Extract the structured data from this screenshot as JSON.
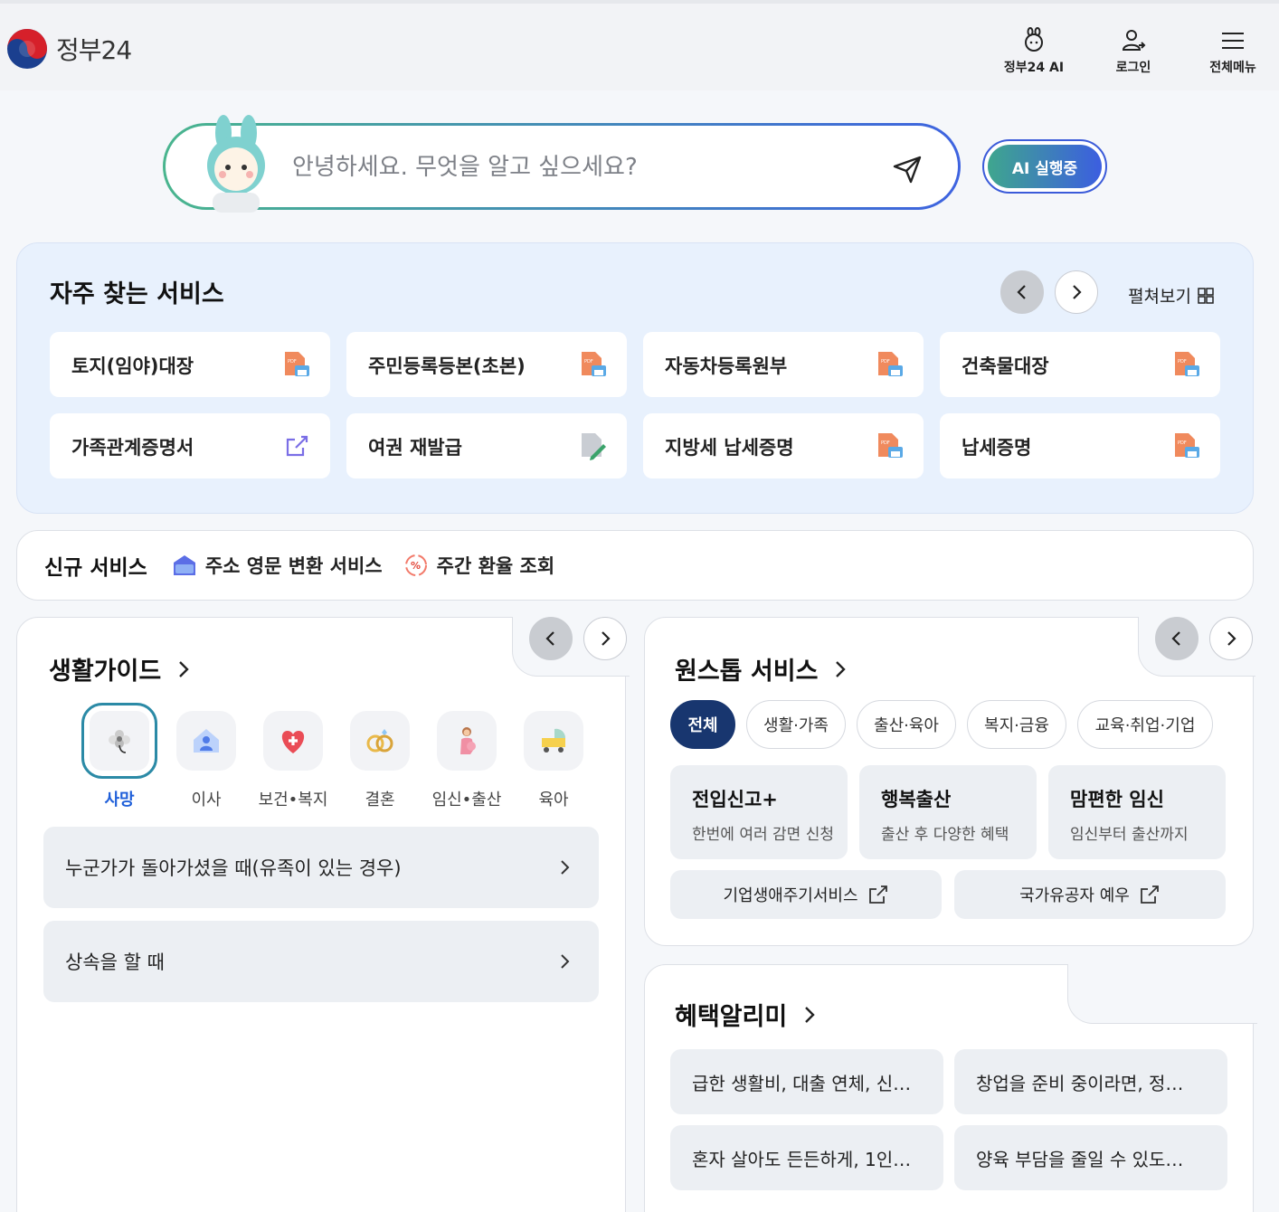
{
  "header": {
    "logo_text": "정부24",
    "nav": [
      {
        "label": "정부24 AI",
        "icon": "ai-mascot-icon"
      },
      {
        "label": "로그인",
        "icon": "user-login-icon"
      },
      {
        "label": "전체메뉴",
        "icon": "hamburger-menu-icon"
      }
    ]
  },
  "search": {
    "placeholder": "안녕하세요. 무엇을 알고 싶으세요?",
    "ai_button": "AI 실행중"
  },
  "frequent": {
    "title": "자주 찾는 서비스",
    "expand_label": "펼쳐보기",
    "items": [
      {
        "label": "토지(임야)대장",
        "icon": "pdf-print-icon"
      },
      {
        "label": "주민등록등본(초본)",
        "icon": "pdf-print-icon"
      },
      {
        "label": "자동차등록원부",
        "icon": "pdf-print-icon"
      },
      {
        "label": "건축물대장",
        "icon": "pdf-print-icon"
      },
      {
        "label": "가족관계증명서",
        "icon": "external-link-icon"
      },
      {
        "label": "여권 재발급",
        "icon": "edit-document-icon"
      },
      {
        "label": "지방세 납세증명",
        "icon": "pdf-print-icon"
      },
      {
        "label": "납세증명",
        "icon": "pdf-print-icon"
      }
    ]
  },
  "new_services": {
    "title": "신규 서비스",
    "items": [
      {
        "label": "주소 영문 변환 서비스",
        "icon": "mailbox-icon"
      },
      {
        "label": "주간 환율 조회",
        "icon": "exchange-rate-icon"
      }
    ]
  },
  "life_guide": {
    "title": "생활가이드",
    "categories": [
      {
        "label": "사망",
        "icon": "flower-icon",
        "active": true
      },
      {
        "label": "이사",
        "icon": "house-icon"
      },
      {
        "label": "보건•복지",
        "icon": "heart-cross-icon"
      },
      {
        "label": "결혼",
        "icon": "rings-icon"
      },
      {
        "label": "임신•출산",
        "icon": "pregnant-woman-icon"
      },
      {
        "label": "육아",
        "icon": "stroller-icon"
      }
    ],
    "rows": [
      {
        "label": "누군가가 돌아가셨을 때(유족이 있는 경우)"
      },
      {
        "label": "상속을 할 때"
      }
    ]
  },
  "one_stop": {
    "title": "원스톱 서비스",
    "chips": [
      "전체",
      "생활·가족",
      "출산·육아",
      "복지·금융",
      "교육·취업·기업"
    ],
    "tiles": [
      {
        "title": "전입신고+",
        "subtitle": "한번에 여러 감면 신청"
      },
      {
        "title": "행복출산",
        "subtitle": "출산 후 다양한 혜택"
      },
      {
        "title": "맘편한 임신",
        "subtitle": "임신부터 출산까지"
      }
    ],
    "links": [
      {
        "label": "기업생애주기서비스"
      },
      {
        "label": "국가유공자 예우"
      }
    ]
  },
  "benefits": {
    "title": "혜택알리미",
    "items": [
      {
        "label": "급한 생활비, 대출 연체, 신…"
      },
      {
        "label": "창업을 준비 중이라면, 정…"
      },
      {
        "label": "혼자 살아도 든든하게, 1인…"
      },
      {
        "label": "양육 부담을 줄일 수 있도…"
      }
    ]
  },
  "colors": {
    "accent_blue": "#1f5fd9",
    "navy": "#18366f",
    "panel_blue": "#e8f1fd"
  }
}
